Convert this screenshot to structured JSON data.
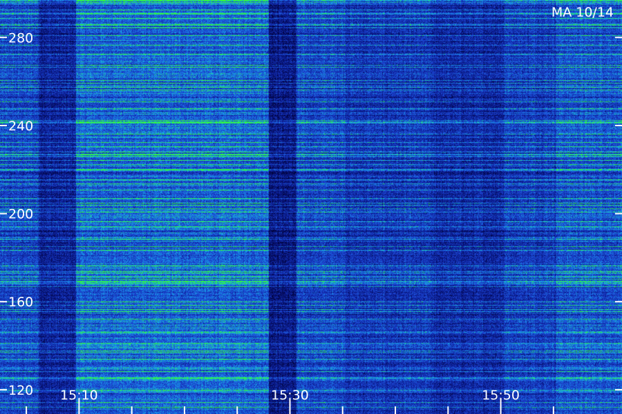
{
  "station_label": "MA 10/14",
  "chart_data": {
    "type": "heatmap",
    "title": "",
    "xlabel": "",
    "ylabel": "",
    "x_tick_labels": [
      "15:10",
      "15:30",
      "15:50"
    ],
    "x_major_ticks_minutes": [
      10,
      30,
      50
    ],
    "x_minor_ticks_minutes": [
      5,
      15,
      20,
      25,
      35,
      40,
      45,
      55
    ],
    "x_range_minutes": [
      2.5,
      61.5
    ],
    "y_ticks": [
      120,
      160,
      200,
      240,
      280
    ],
    "y_range": [
      109,
      297
    ],
    "colormap": [
      "#000033",
      "#0a1a8c",
      "#1d47d6",
      "#17a6e8",
      "#33ff33"
    ],
    "column_bands": [
      {
        "from": 2.5,
        "to": 6.2,
        "level": 0.45
      },
      {
        "from": 6.2,
        "to": 9.7,
        "level": 0.28
      },
      {
        "from": 9.7,
        "to": 28.0,
        "level": 0.55
      },
      {
        "from": 28.0,
        "to": 30.6,
        "level": 0.22
      },
      {
        "from": 30.6,
        "to": 35.3,
        "level": 0.45
      },
      {
        "from": 35.3,
        "to": 43.5,
        "level": 0.38
      },
      {
        "from": 43.5,
        "to": 50.3,
        "level": 0.32
      },
      {
        "from": 50.3,
        "to": 55.3,
        "level": 0.42
      },
      {
        "from": 55.3,
        "to": 61.5,
        "level": 0.5
      }
    ]
  },
  "colors": {
    "axis": "#ffffff"
  }
}
